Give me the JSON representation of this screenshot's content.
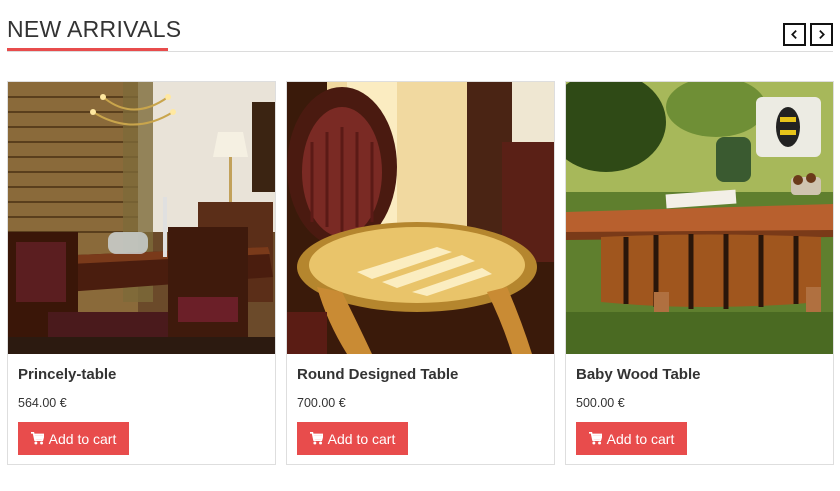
{
  "section": {
    "title": "NEW ARRIVALS",
    "prev_icon": "chevron-left-icon",
    "next_icon": "chevron-right-icon"
  },
  "colors": {
    "accent": "#e84c4c",
    "text": "#333333",
    "border": "#dedede"
  },
  "products": [
    {
      "name": "Princely-table",
      "price": "564.00 €",
      "button_label": "Add to cart",
      "button_icon": "cart-icon",
      "image": "dining-room-photo"
    },
    {
      "name": "Round Designed Table",
      "price": "700.00 €",
      "button_label": "Add to cart",
      "button_icon": "cart-icon",
      "image": "round-table-photo"
    },
    {
      "name": "Baby Wood Table",
      "price": "500.00 €",
      "button_label": "Add to cart",
      "button_icon": "cart-icon",
      "image": "barrel-table-photo"
    }
  ]
}
